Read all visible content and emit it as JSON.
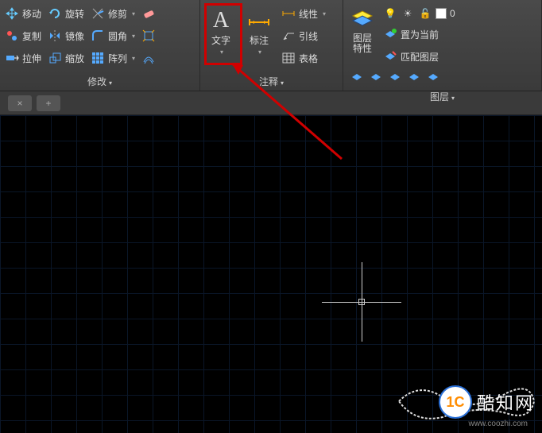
{
  "panels": {
    "modify": {
      "title": "修改",
      "move": "移动",
      "rotate": "旋转",
      "trim": "修剪",
      "copy": "复制",
      "mirror": "镜像",
      "fillet": "圆角",
      "stretch": "拉伸",
      "scale": "缩放",
      "array": "阵列"
    },
    "annotation": {
      "title": "注释",
      "text": "文字",
      "dimension": "标注",
      "linear": "线性",
      "leader": "引线",
      "table": "表格"
    },
    "layers": {
      "title": "图层",
      "properties": "图层\n特性",
      "set_current": "置为当前",
      "match_layer": "匹配图层",
      "current_layer": "0"
    }
  },
  "watermark": {
    "brand": "酷知网",
    "url": "www.coozhi.com",
    "logo_text": "1C"
  }
}
